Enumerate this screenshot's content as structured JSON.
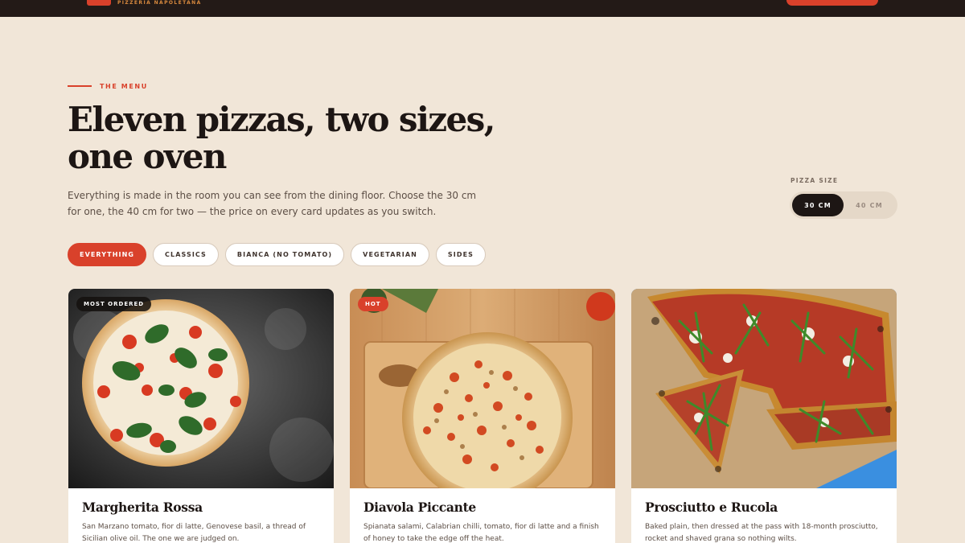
{
  "brand": {
    "subtitle": "PIZZERIA NAPOLETANA"
  },
  "header": {
    "eyebrow": "THE MENU",
    "title": "Eleven pizzas, two sizes, one oven",
    "lede": "Everything is made in the room you can see from the dining floor. Choose the 30 cm for one, the 40 cm for two — the price on every card updates as you switch."
  },
  "size_toggle": {
    "label": "PIZZA SIZE",
    "options": [
      "30 CM",
      "40 CM"
    ],
    "selected": "30 CM"
  },
  "filters": [
    {
      "label": "EVERYTHING",
      "active": true
    },
    {
      "label": "CLASSICS",
      "active": false
    },
    {
      "label": "BIANCA (NO TOMATO)",
      "active": false
    },
    {
      "label": "VEGETARIAN",
      "active": false
    },
    {
      "label": "SIDES",
      "active": false
    }
  ],
  "cards": [
    {
      "badge": "MOST ORDERED",
      "name": "Margherita Rossa",
      "description": "San Marzano tomato, fior di latte, Genovese basil, a thread of Sicilian olive oil. The one we are judged on."
    },
    {
      "badge": "HOT",
      "name": "Diavola Piccante",
      "description": "Spianata salami, Calabrian chilli, tomato, fior di latte and a finish of honey to take the edge off the heat."
    },
    {
      "badge": "",
      "name": "Prosciutto e Rucola",
      "description": "Baked plain, then dressed at the pass with 18-month prosciutto, rocket and shaved grana so nothing wilts."
    }
  ],
  "colors": {
    "accent": "#d9412b",
    "background": "#f1e6d8",
    "dark": "#231a17"
  }
}
